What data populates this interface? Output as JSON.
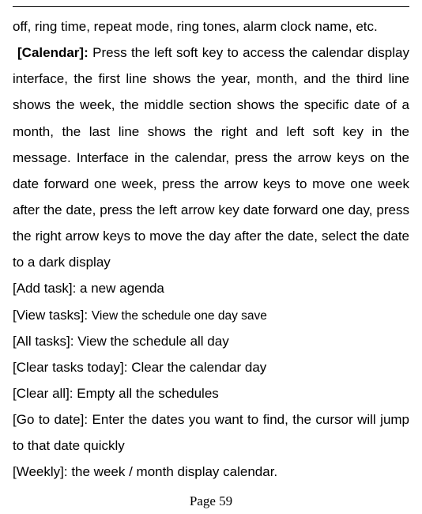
{
  "intro_line": "off, ring time, repeat mode, ring tones, alarm clock name, etc.",
  "calendar": {
    "heading": "[Calendar]: ",
    "body": "Press the left soft key to access the calendar display interface, the first line shows the year, month, and the third line shows the week, the middle section shows the specific date of a month, the last line shows the right and left soft key in the message. Interface in the calendar, press the arrow keys on the date forward one week, press the arrow keys to move one week after the date, press the left arrow key date forward one day, press the right arrow keys to move the day after the date, select the date to a dark display"
  },
  "items": [
    {
      "label": "[Add task]: ",
      "desc": "a new agenda",
      "small": false
    },
    {
      "label": "[View tasks]: ",
      "desc": "View the schedule one day save",
      "small": true
    },
    {
      "label": "[All tasks]: ",
      "desc": "View the schedule all day",
      "small": false
    },
    {
      "label": "[Clear tasks today]: ",
      "desc": "Clear the calendar day",
      "small": false
    },
    {
      "label": "[Clear all]: ",
      "desc": "Empty all the schedules",
      "small": false
    },
    {
      "label": "[Go to date]: ",
      "desc": "Enter the dates you want to find, the cursor will jump to that date quickly",
      "small": false
    },
    {
      "label": "[Weekly]: ",
      "desc": "the week / month display calendar.",
      "small": false
    }
  ],
  "page_number": "Page 59"
}
